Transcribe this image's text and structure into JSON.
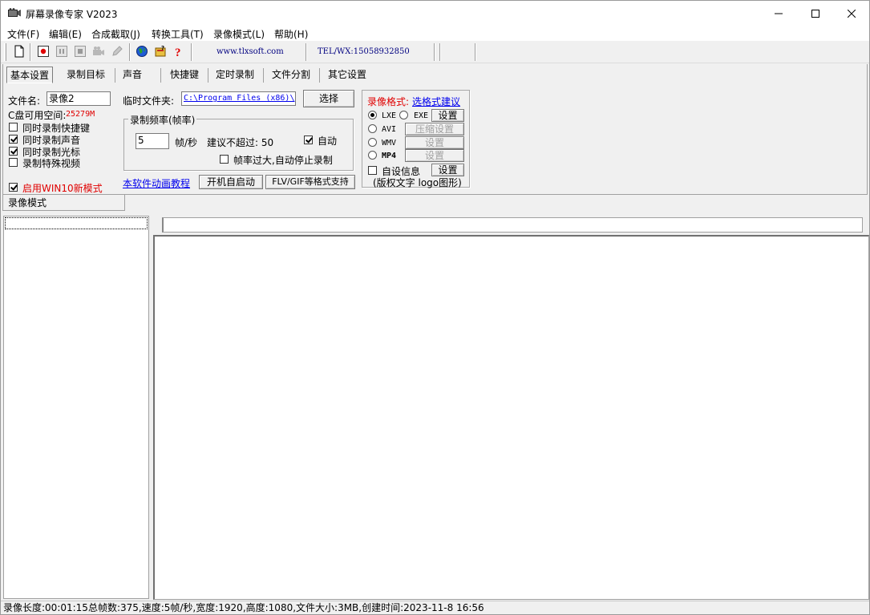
{
  "window": {
    "title": "屏幕录像专家 V2023"
  },
  "menu": [
    "文件(F)",
    "编辑(E)",
    "合成截取(J)",
    "转换工具(T)",
    "录像模式(L)",
    "帮助(H)"
  ],
  "toolbar": {
    "website": "www.tlxsoft.com",
    "phone": "TEL/WX:15058932850",
    "icons": [
      "new-file-icon",
      "record-icon",
      "pause-icon",
      "stop-icon",
      "camera-icon",
      "pen-icon",
      "globe-icon",
      "help-book-icon",
      "help-icon"
    ]
  },
  "tabs": [
    "基本设置",
    "录制目标",
    "声音",
    "快捷键",
    "定时录制",
    "文件分割",
    "其它设置"
  ],
  "basic": {
    "filename_label": "文件名:",
    "filename_value": "录像2",
    "disk_label": "C盘可用空间:",
    "disk_value": "25279M",
    "checkboxes": [
      {
        "label": "同时录制快捷键",
        "checked": false
      },
      {
        "label": "同时录制声音",
        "checked": true
      },
      {
        "label": "同时录制光标",
        "checked": true
      },
      {
        "label": "录制特殊视频",
        "checked": false
      }
    ],
    "win10_label": "启用WIN10新模式",
    "win10_checked": true,
    "temp_label": "临时文件夹:",
    "temp_value": "C:\\Program Files (x86)\\",
    "choose_button": "选择",
    "fps_group_title": "录制频率(帧率)",
    "fps_value": "5",
    "fps_unit": "帧/秒",
    "fps_hint": "建议不超过: 50",
    "auto_label": "自动",
    "auto_checked": true,
    "stop_label": "帧率过大,自动停止录制",
    "stop_checked": false,
    "tutorial_link": "本软件动画教程",
    "autostart_button": "开机自启动",
    "flv_button": "FLV/GIF等格式支持"
  },
  "format": {
    "title": "录像格式:",
    "suggest_link": "选格式建议",
    "options": [
      {
        "label": "LXE",
        "checked": true
      },
      {
        "label": "EXE",
        "checked": false
      },
      {
        "label": "AVI",
        "checked": false
      },
      {
        "label": "WMV",
        "checked": false
      },
      {
        "label": "MP4",
        "checked": false
      }
    ],
    "settings_label": "设置",
    "compress_label": "压缩设置",
    "custom_info_label": "自设信息",
    "custom_info_checked": false,
    "copyright_note": "(版权文字 logo图形)"
  },
  "record_mode_tab": "录像模式",
  "status": "录像长度:00:01:15总帧数:375,速度:5帧/秒,宽度:1920,高度:1080,文件大小:3MB,创建时间:2023-11-8 16:56",
  "colors": {
    "warning_red": "#e00000",
    "link_blue": "#0000ee",
    "url_navy": "#000080"
  }
}
